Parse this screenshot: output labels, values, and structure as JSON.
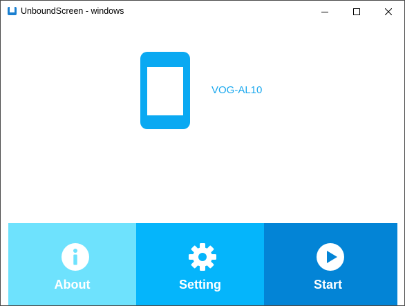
{
  "window": {
    "title": "UnboundScreen - windows"
  },
  "device": {
    "name": "VOG-AL10",
    "icon": "phone-icon"
  },
  "actions": [
    {
      "label": "About",
      "icon": "info-icon",
      "color": "#6ee2fd"
    },
    {
      "label": "Setting",
      "icon": "gear-icon",
      "color": "#05b5fb"
    },
    {
      "label": "Start",
      "icon": "play-icon",
      "color": "#0384d6"
    }
  ],
  "colors": {
    "accent": "#0aa9f2",
    "device_text": "#1aa8ee"
  }
}
